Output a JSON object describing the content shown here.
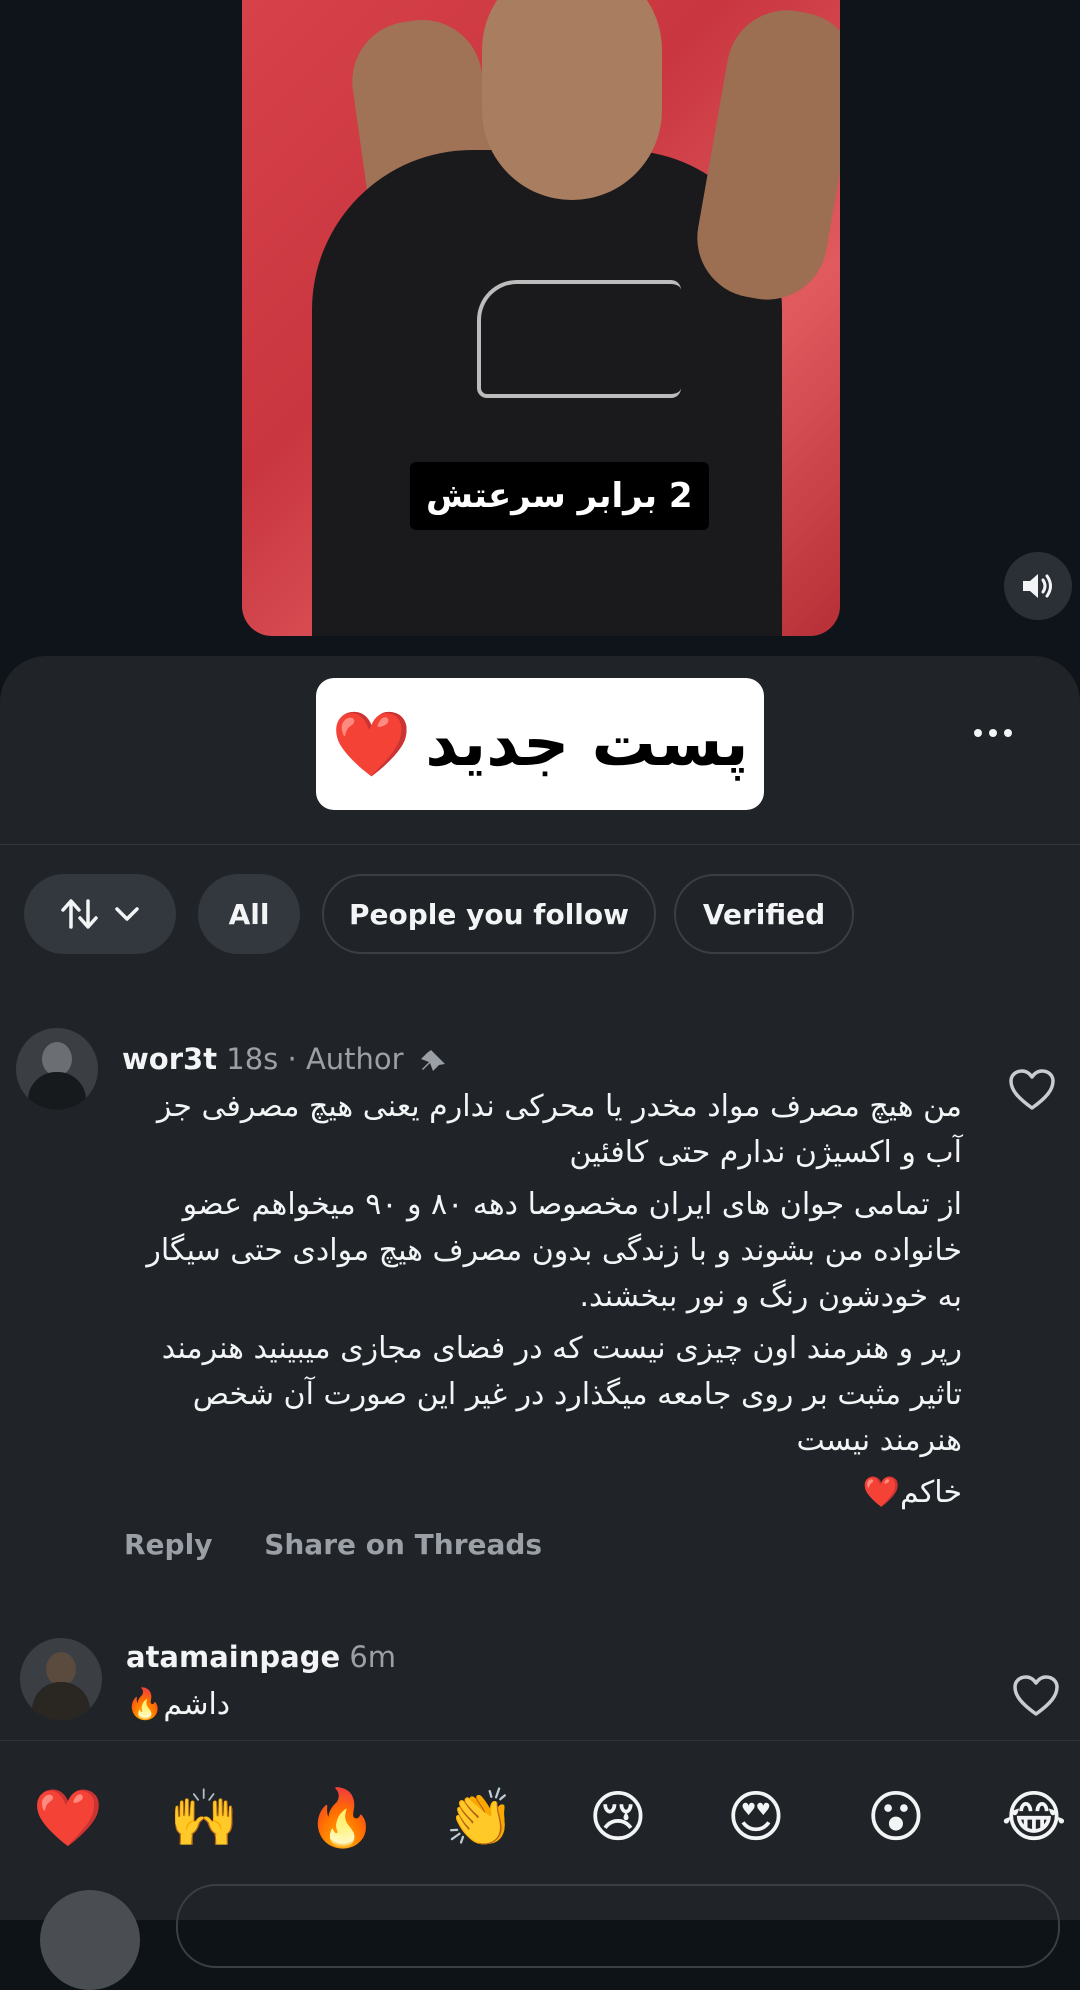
{
  "video": {
    "caption": "2 برابر سرعتش",
    "mute_icon": "speaker-icon"
  },
  "sheet": {
    "title": "پست جدید",
    "title_emoji": "❤️",
    "more_icon": "ellipsis-icon"
  },
  "filters": {
    "sort_icon": "sort-arrows-icon",
    "all": "All",
    "people_you_follow": "People you follow",
    "verified": "Verified"
  },
  "comments": [
    {
      "username": "wor3t",
      "time": "18s",
      "badge": "· Author",
      "paragraphs": [
        "من هیچ مصرف مواد مخدر یا محرکی ندارم یعنی هیچ مصرفی جز آب و اکسیژن ندارم حتی کافئین",
        "از تمامی جوان های ایران مخصوصا دهه ۸۰ و ۹۰ میخواهم عضو خانواده من بشوند و با زندگی بدون مصرف هیچ موادی حتی سیگار به خودشون رنگ و نور ببخشند.",
        "رپر و هنرمند اون چیزی نیست که در فضای مجازی میبینید هنرمند تاثیر مثبت بر روی جامعه میگذارد در غیر این صورت آن شخص هنرمند نیست",
        "خاکم❤️"
      ],
      "reply": "Reply",
      "share": "Share on Threads"
    },
    {
      "username": "atamainpage",
      "time": "6m",
      "paragraphs": [
        "داشم🔥"
      ]
    }
  ],
  "emoji_bar": [
    "❤️",
    "🙌",
    "🔥",
    "👏",
    "😢",
    "😍",
    "😮",
    "😂"
  ]
}
